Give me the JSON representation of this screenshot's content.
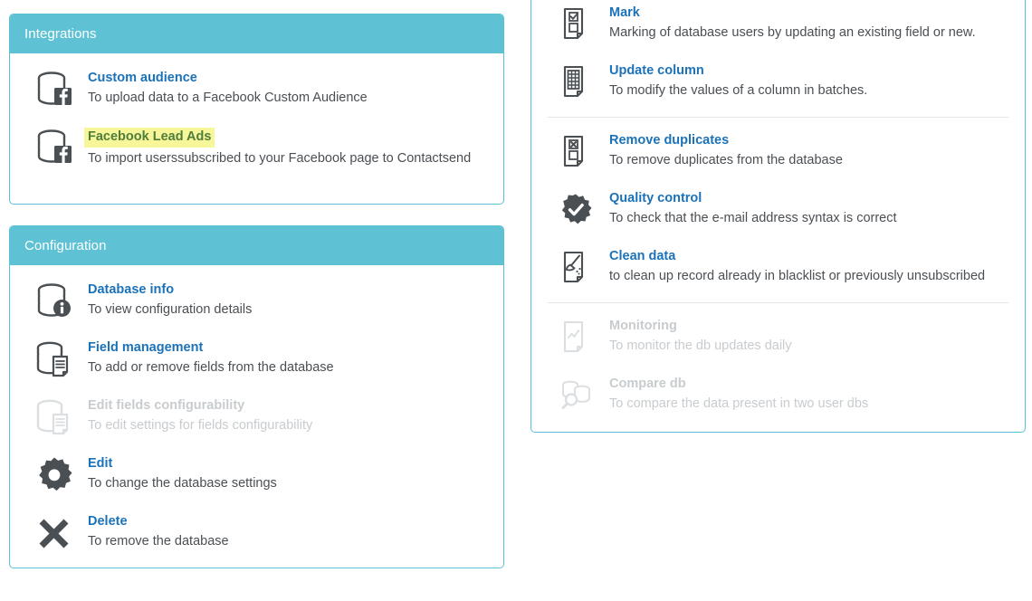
{
  "theme": {
    "header_bg": "#5ec2d4",
    "panel_border": "#5cc0d6",
    "link_blue": "#1b72b8",
    "body_text": "#4a4f54",
    "disabled_text": "#c8cccf",
    "highlight_bg": "#f7f79a",
    "highlight_text": "#4f7d3b"
  },
  "panels": {
    "integrations": {
      "header": "Integrations",
      "items": [
        {
          "icon": "database-facebook-icon",
          "title": "Custom audience",
          "desc": "To upload data to a Facebook Custom Audience",
          "disabled": false,
          "highlighted": false
        },
        {
          "icon": "database-facebook-icon",
          "title": "Facebook Lead Ads",
          "desc": "To import userssubscribed to your Facebook page to Contactsend",
          "disabled": false,
          "highlighted": true
        }
      ]
    },
    "configuration": {
      "header": "Configuration",
      "items": [
        {
          "icon": "database-info-icon",
          "title": "Database info",
          "desc": "To view configuration details",
          "disabled": false,
          "highlighted": false
        },
        {
          "icon": "database-document-icon",
          "title": "Field management",
          "desc": "To add or remove fields from the database",
          "disabled": false,
          "highlighted": false
        },
        {
          "icon": "database-document-disabled-icon",
          "title": "Edit fields configurability",
          "desc": "To edit settings for fields configurability",
          "disabled": true,
          "highlighted": false
        },
        {
          "icon": "gear-icon",
          "title": "Edit",
          "desc": "To change the database settings",
          "disabled": false,
          "highlighted": false
        },
        {
          "icon": "close-cross-icon",
          "title": "Delete",
          "desc": "To remove the database",
          "disabled": false,
          "highlighted": false
        }
      ]
    },
    "operations": {
      "items": [
        {
          "icon": "document-checkbox-icon",
          "title": "Mark",
          "desc": "Marking of database users by updating an existing field or new.",
          "disabled": false,
          "highlighted": false
        },
        {
          "icon": "document-table-icon",
          "title": "Update column",
          "desc": "To modify the values of a column in batches.",
          "disabled": false,
          "highlighted": false
        },
        {
          "icon": "document-x-icon",
          "title": "Remove duplicates",
          "desc": "To remove duplicates from the database",
          "disabled": false,
          "highlighted": false
        },
        {
          "icon": "check-badge-icon",
          "title": "Quality control",
          "desc": "To check that the e-mail address syntax is correct",
          "disabled": false,
          "highlighted": false
        },
        {
          "icon": "document-broom-icon",
          "title": "Clean data",
          "desc": "to clean up record already in blacklist or previously unsubscribed",
          "disabled": false,
          "highlighted": false
        },
        {
          "icon": "document-chart-disabled-icon",
          "title": "Monitoring",
          "desc": "To monitor the db updates daily",
          "disabled": true,
          "highlighted": false
        },
        {
          "icon": "database-compare-disabled-icon",
          "title": "Compare db",
          "desc": "To compare the data present in two user dbs",
          "disabled": true,
          "highlighted": false
        }
      ]
    }
  }
}
